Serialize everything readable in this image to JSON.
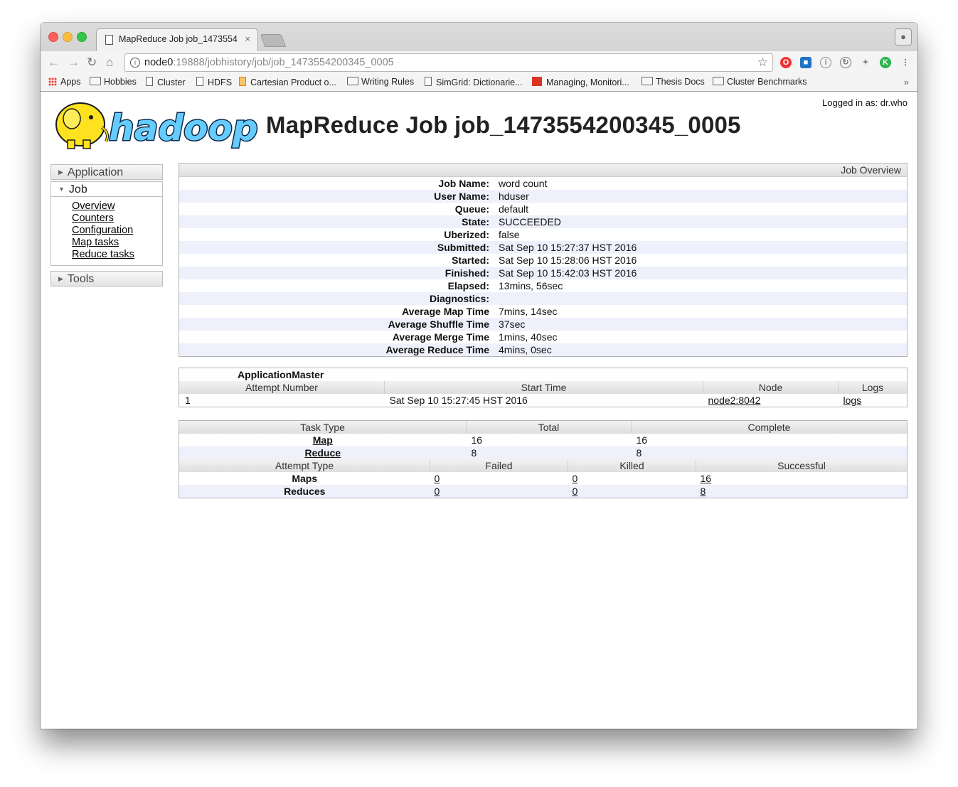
{
  "browser": {
    "tab_title": "MapReduce Job job_1473554",
    "tab_close": "×",
    "url_host": "node0",
    "url_rest": ":19888/jobhistory/job/job_1473554200345_0005",
    "bookmarks": [
      "Apps",
      "Hobbies",
      "Cluster",
      "HDFS",
      "Cartesian Product o...",
      "Writing Rules",
      "SimGrid: Dictionarie...",
      "Managing, Monitori...",
      "Thesis Docs",
      "Cluster Benchmarks"
    ],
    "more": "»"
  },
  "header": {
    "logged_in": "Logged in as: dr.who",
    "logo_text": "hadoop",
    "title": "MapReduce Job job_1473554200345_0005"
  },
  "sidebar": {
    "application": "Application",
    "job": "Job",
    "job_links": [
      "Overview",
      "Counters",
      "Configuration",
      "Map tasks",
      "Reduce tasks"
    ],
    "tools": "Tools"
  },
  "overview": {
    "heading": "Job Overview",
    "rows": [
      {
        "k": "Job Name:",
        "v": "word count"
      },
      {
        "k": "User Name:",
        "v": "hduser"
      },
      {
        "k": "Queue:",
        "v": "default"
      },
      {
        "k": "State:",
        "v": "SUCCEEDED"
      },
      {
        "k": "Uberized:",
        "v": "false"
      },
      {
        "k": "Submitted:",
        "v": "Sat Sep 10 15:27:37 HST 2016"
      },
      {
        "k": "Started:",
        "v": "Sat Sep 10 15:28:06 HST 2016"
      },
      {
        "k": "Finished:",
        "v": "Sat Sep 10 15:42:03 HST 2016"
      },
      {
        "k": "Elapsed:",
        "v": "13mins, 56sec"
      },
      {
        "k": "Diagnostics:",
        "v": ""
      },
      {
        "k": "Average Map Time",
        "v": "7mins, 14sec"
      },
      {
        "k": "Average Shuffle Time",
        "v": "37sec"
      },
      {
        "k": "Average Merge Time",
        "v": "1mins, 40sec"
      },
      {
        "k": "Average Reduce Time",
        "v": "4mins, 0sec"
      }
    ]
  },
  "am": {
    "caption": "ApplicationMaster",
    "headers": [
      "Attempt Number",
      "Start Time",
      "Node",
      "Logs"
    ],
    "row": {
      "attempt": "1",
      "start": "Sat Sep 10 15:27:45 HST 2016",
      "node": "node2:8042",
      "logs": "logs"
    }
  },
  "tasks": {
    "headers": [
      "Task Type",
      "Total",
      "Complete"
    ],
    "rows": [
      {
        "type": "Map",
        "total": "16",
        "complete": "16"
      },
      {
        "type": "Reduce",
        "total": "8",
        "complete": "8"
      }
    ],
    "attempt_headers": [
      "Attempt Type",
      "Failed",
      "Killed",
      "Successful"
    ],
    "attempt_rows": [
      {
        "type": "Maps",
        "failed": "0",
        "killed": "0",
        "successful": "16"
      },
      {
        "type": "Reduces",
        "failed": "0",
        "killed": "0",
        "successful": "8"
      }
    ]
  }
}
